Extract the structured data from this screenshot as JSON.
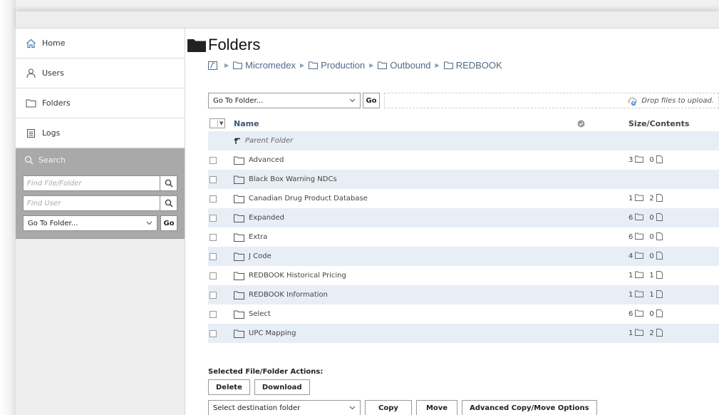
{
  "sidebar": {
    "nav": [
      {
        "label": "Home",
        "icon": "home-icon"
      },
      {
        "label": "Users",
        "icon": "users-icon"
      },
      {
        "label": "Folders",
        "icon": "folder-icon"
      },
      {
        "label": "Logs",
        "icon": "logs-icon"
      }
    ],
    "search": {
      "title": "Search",
      "file_placeholder": "Find File/Folder",
      "user_placeholder": "Find User",
      "goto_value": "Go To Folder...",
      "go_label": "Go"
    }
  },
  "main": {
    "title": "Folders",
    "breadcrumb": [
      "Micromedex",
      "Production",
      "Outbound",
      "REDBOOK"
    ],
    "toolbar": {
      "goto_value": "Go To Folder...",
      "go_label": "Go",
      "drop_text": "Drop files to upload."
    },
    "table": {
      "headers": {
        "name": "Name",
        "size": "Size/Contents"
      },
      "parent_label": "Parent Folder",
      "rows": [
        {
          "name": "Advanced",
          "folders": "3",
          "files": "0"
        },
        {
          "name": "Black Box Warning NDCs",
          "folders": "",
          "files": ""
        },
        {
          "name": "Canadian Drug Product Database",
          "folders": "1",
          "files": "2"
        },
        {
          "name": "Expanded",
          "folders": "6",
          "files": "0"
        },
        {
          "name": "Extra",
          "folders": "6",
          "files": "0"
        },
        {
          "name": "J Code",
          "folders": "4",
          "files": "0"
        },
        {
          "name": "REDBOOK Historical Pricing",
          "folders": "1",
          "files": "1"
        },
        {
          "name": "REDBOOK Information",
          "folders": "1",
          "files": "1"
        },
        {
          "name": "Select",
          "folders": "6",
          "files": "0"
        },
        {
          "name": "UPC Mapping",
          "folders": "1",
          "files": "2"
        }
      ]
    },
    "actions": {
      "label": "Selected File/Folder Actions:",
      "delete": "Delete",
      "download": "Download",
      "dest_value": "Select destination folder",
      "copy": "Copy",
      "move": "Move",
      "advanced": "Advanced Copy/Move Options"
    }
  },
  "colors": {
    "link": "#506a8a",
    "row_alt": "#e8eef6",
    "search_panel": "#a9a9a9"
  }
}
